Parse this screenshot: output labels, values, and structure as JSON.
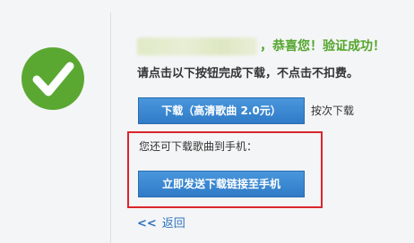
{
  "status": {
    "icon": "checkmark-circle-icon",
    "success_message": "，恭喜您！验证成功！",
    "instruction": "请点击以下按钮完成下载，不点击不扣费。"
  },
  "download": {
    "button_label": "下载（高清歌曲 2.0元）",
    "count_label": "按次下载"
  },
  "phone": {
    "prompt": "您还可下载歌曲到手机：",
    "button_label": "立即发送下载链接至手机"
  },
  "nav": {
    "back_chevron": "<<",
    "back_label": "返回"
  },
  "colors": {
    "accent_green": "#52a52a",
    "button_blue": "#2f7bc7",
    "highlight_red": "#d9262c",
    "link_blue": "#2f74c0"
  }
}
